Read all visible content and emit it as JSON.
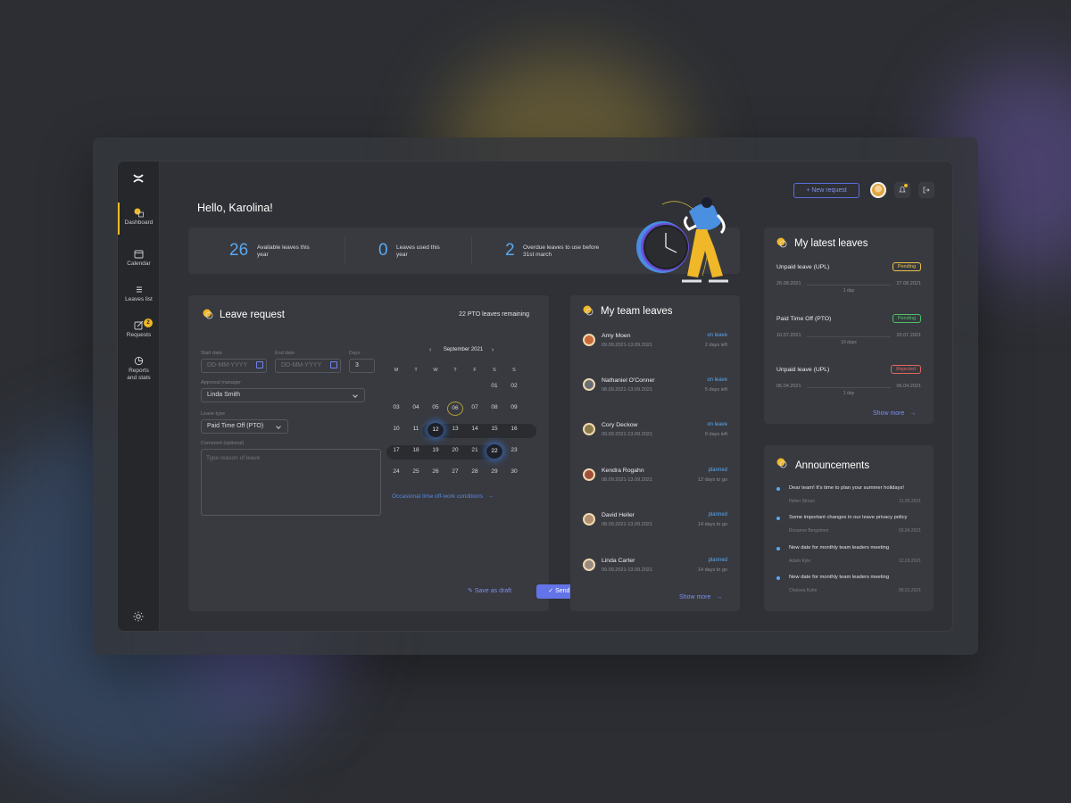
{
  "sidebar": {
    "items": [
      {
        "label": "Dashboard",
        "icon": "dashboard-icon"
      },
      {
        "label": "Calendar",
        "icon": "calendar-icon"
      },
      {
        "label": "Leaves list",
        "icon": "list-icon"
      },
      {
        "label": "Requests",
        "icon": "edit-icon",
        "badge": "2"
      },
      {
        "label": "Reports and stats",
        "icon": "pie-chart-icon"
      }
    ]
  },
  "header": {
    "greeting": "Hello, Karolina!",
    "new_request": "+ New request"
  },
  "stats": [
    {
      "value": "26",
      "label": "Available leaves this year"
    },
    {
      "value": "0",
      "label": "Leaves used this year"
    },
    {
      "value": "2",
      "label": "Overdue leaves to use before 31st march"
    }
  ],
  "leave_request": {
    "title": "Leave request",
    "pto_remaining": "22 PTO leaves remaining",
    "start_label": "Start date",
    "start_placeholder": "DD-MM-YYYY",
    "end_label": "End date",
    "end_placeholder": "DD-MM-YYYY",
    "days_label": "Days",
    "days_value": "3",
    "manager_label": "Approval manager",
    "manager_value": "Linda Smith",
    "type_label": "Leave type",
    "type_value": "Paid Time Off (PTO)",
    "comment_label": "Comment (optional)",
    "comment_placeholder": "Type reason of leave",
    "conditions_link": "Occasional time off-work conditions",
    "save_draft": "Save as draft",
    "send": "Send request",
    "calendar": {
      "month": "September 2021",
      "weekdays": [
        "M",
        "T",
        "W",
        "T",
        "F",
        "S",
        "S"
      ],
      "weeks": [
        [
          "",
          "",
          "",
          "",
          "",
          "01",
          "02"
        ],
        [
          "03",
          "04",
          "05",
          "06",
          "07",
          "08",
          "09"
        ],
        [
          "10",
          "11",
          "12",
          "13",
          "14",
          "15",
          "16"
        ],
        [
          "17",
          "18",
          "19",
          "20",
          "21",
          "22",
          "23"
        ],
        [
          "24",
          "25",
          "26",
          "27",
          "28",
          "29",
          "30"
        ]
      ]
    }
  },
  "team_leaves": {
    "title": "My team leaves",
    "show_more": "Show more",
    "rows": [
      {
        "name": "Amy Moen",
        "dates": "09.09.2021-13.09.2021",
        "status": "on leave",
        "remaining": "2 days left"
      },
      {
        "name": "Nathaniel O'Conner",
        "dates": "08.09.2021-13.09.2021",
        "status": "on leave",
        "remaining": "5 days left"
      },
      {
        "name": "Cory Deckow",
        "dates": "09.09.2021-13.09.2021",
        "status": "on leave",
        "remaining": "9 days left"
      },
      {
        "name": "Kendra Rogahn",
        "dates": "08.09.2021-13.09.2021",
        "status": "planned",
        "remaining": "12 days to go"
      },
      {
        "name": "David Heller",
        "dates": "08.09.2021-13.09.2021",
        "status": "planned",
        "remaining": "14 days to go"
      },
      {
        "name": "Linda Carter",
        "dates": "09.09.2021-13.09.2021",
        "status": "planned",
        "remaining": "14 days to go"
      }
    ]
  },
  "latest_leaves": {
    "title": "My latest leaves",
    "show_more": "Show more",
    "items": [
      {
        "type": "Unpaid leave (UPL)",
        "status": "Pending",
        "start": "26.08.2021",
        "end": "27.08.2021",
        "duration": "1 day"
      },
      {
        "type": "Paid Time Off (PTO)",
        "status": "Pending",
        "start": "10.07.2021",
        "end": "20.07.2021",
        "duration": "10 days"
      },
      {
        "type": "Unpaid leave (UPL)",
        "status": "Rejected",
        "start": "05.04.2021",
        "end": "06.04.2021",
        "duration": "1 day"
      }
    ]
  },
  "announcements": {
    "title": "Announcements",
    "items": [
      {
        "text": "Dear team! It's time to plan your summer holidays!",
        "author": "Helen Strozo",
        "date": "11.05.2021"
      },
      {
        "text": "Some important changes in our leave privacy policy",
        "author": "Roxanne Bergstrom",
        "date": "03.04.2021"
      },
      {
        "text": "New date for monthly team leaders meeting",
        "author": "Adam Kyle",
        "date": "12.03.2021"
      },
      {
        "text": "New date for monthly team leaders meeting",
        "author": "Chelsea Kuhn",
        "date": "06.01.2021"
      }
    ]
  },
  "colors": {
    "accent": "#6374e8",
    "highlight": "#5aa8f0",
    "warning": "#f2b824"
  }
}
